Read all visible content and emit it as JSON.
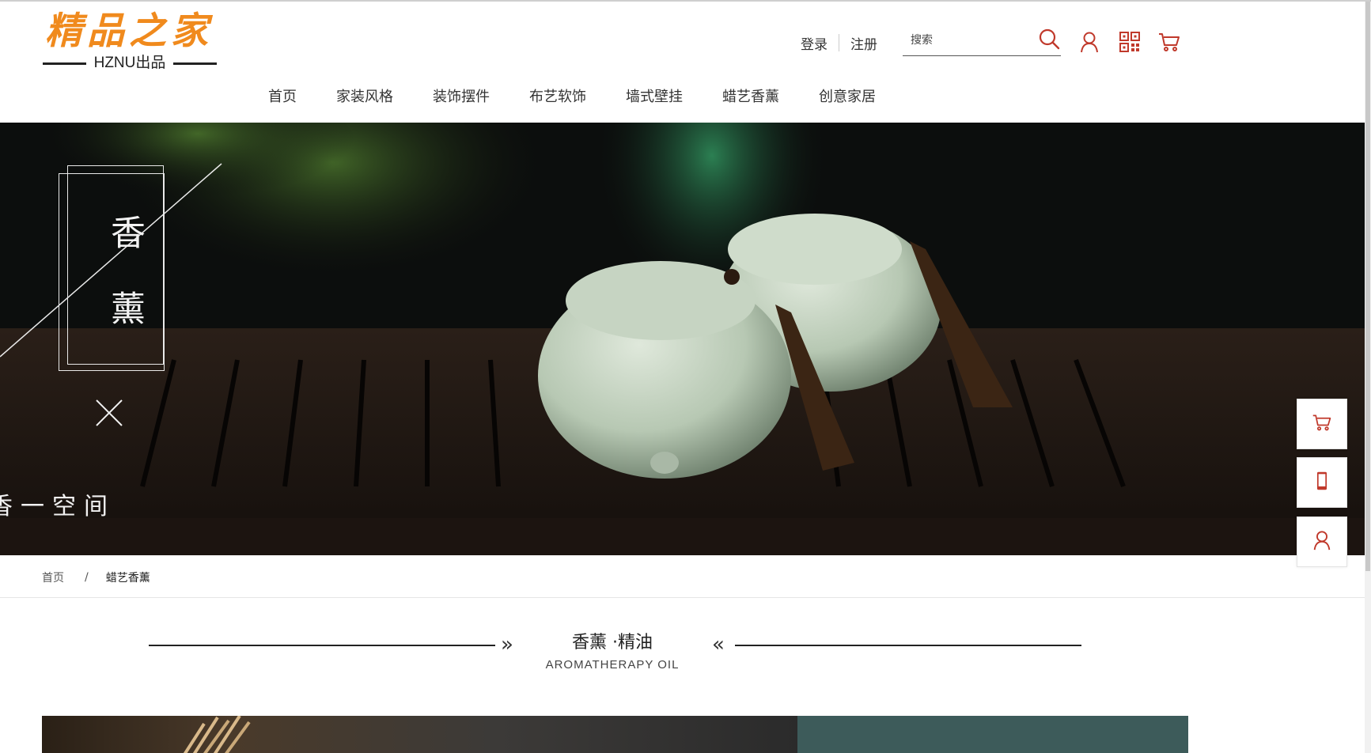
{
  "logo": {
    "title": "精品之家",
    "subtitle": "HZNU出品"
  },
  "header": {
    "login": "登录",
    "register": "注册",
    "search_placeholder": "搜索",
    "icons": [
      "search-icon",
      "user-icon",
      "qr-code-icon",
      "cart-icon"
    ]
  },
  "nav": {
    "items": [
      {
        "label": "首页"
      },
      {
        "label": "家装风格"
      },
      {
        "label": "装饰摆件"
      },
      {
        "label": "布艺软饰"
      },
      {
        "label": "墙式壁挂"
      },
      {
        "label": "蜡艺香薰"
      },
      {
        "label": "创意家居"
      }
    ]
  },
  "banner": {
    "vertical_title": "香薰",
    "cross_mark": "✕",
    "tagline": "香一空间"
  },
  "side_buttons": [
    "cart-icon",
    "mobile-icon",
    "user-icon"
  ],
  "breadcrumb": {
    "home": "首页",
    "separator": "/",
    "current": "蜡艺香薰"
  },
  "section": {
    "title": "香薰 ·精油",
    "subtitle": "AROMATHERAPY OIL",
    "left_arrow": "»",
    "right_arrow": "«"
  },
  "colors": {
    "brand_orange": "#f08a1d",
    "icon_red": "#c0392b",
    "text": "#333333"
  }
}
